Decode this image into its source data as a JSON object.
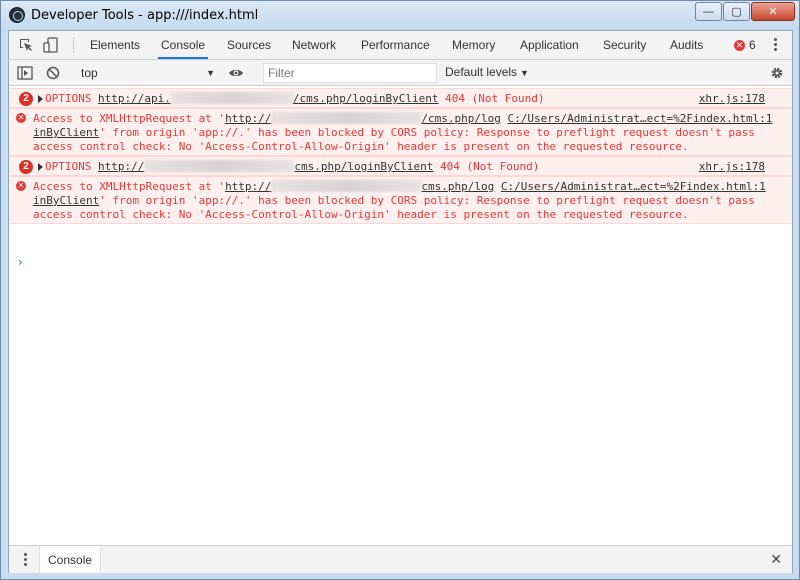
{
  "window": {
    "title": "Developer Tools - app:///index.html",
    "buttons": [
      "—",
      "▢",
      "✕"
    ]
  },
  "tabs": [
    {
      "label": "Elements",
      "active": false
    },
    {
      "label": "Console",
      "active": true
    },
    {
      "label": "Sources",
      "active": false
    },
    {
      "label": "Network",
      "active": false
    },
    {
      "label": "Performance",
      "active": false
    },
    {
      "label": "Memory",
      "active": false
    },
    {
      "label": "Application",
      "active": false
    },
    {
      "label": "Security",
      "active": false
    },
    {
      "label": "Audits",
      "active": false
    }
  ],
  "error_badge": {
    "count": "6"
  },
  "toolbar": {
    "context": "top",
    "filter_placeholder": "Filter",
    "levels": "Default levels"
  },
  "messages": [
    {
      "count": "2",
      "method": "OPTIONS",
      "url_start": "http://api.",
      "url_end": "/cms.php/loginByClient",
      "status": "404 (Not Found)",
      "source": "xhr.js:178"
    },
    {
      "line1_prefix": "Access to XMLHttpRequest at '",
      "line1_url_start": "http://",
      "line1_url_end": "/cms.php/log",
      "line1_file": "C:/Users/Administrat…ect=%2Findex.html:1",
      "line2_url_cont": "inByClient",
      "line2_text": "' from origin 'app://.' has been blocked by CORS policy: Response to preflight request doesn't pass",
      "line3_text": "access control check: No 'Access-Control-Allow-Origin' header is present on the requested resource."
    },
    {
      "count": "2",
      "method": "OPTIONS",
      "url_start": "http://",
      "url_end": "cms.php/loginByClient",
      "status": "404 (Not Found)",
      "source": "xhr.js:178"
    },
    {
      "line1_prefix": "Access to XMLHttpRequest at '",
      "line1_url_start": "http://",
      "line1_url_end": "cms.php/log",
      "line1_file": "C:/Users/Administrat…ect=%2Findex.html:1",
      "line2_url_cont": "inByClient",
      "line2_text": "' from origin 'app://.' has been blocked by CORS policy: Response to preflight request doesn't pass",
      "line3_text": "access control check: No 'Access-Control-Allow-Origin' header is present on the requested resource."
    }
  ],
  "prompt": "›",
  "drawer": {
    "tab": "Console",
    "close": "✕"
  },
  "colors": {
    "error": "#e53935",
    "accent": "#1a73e8",
    "error_bg": "#fff0f0"
  }
}
